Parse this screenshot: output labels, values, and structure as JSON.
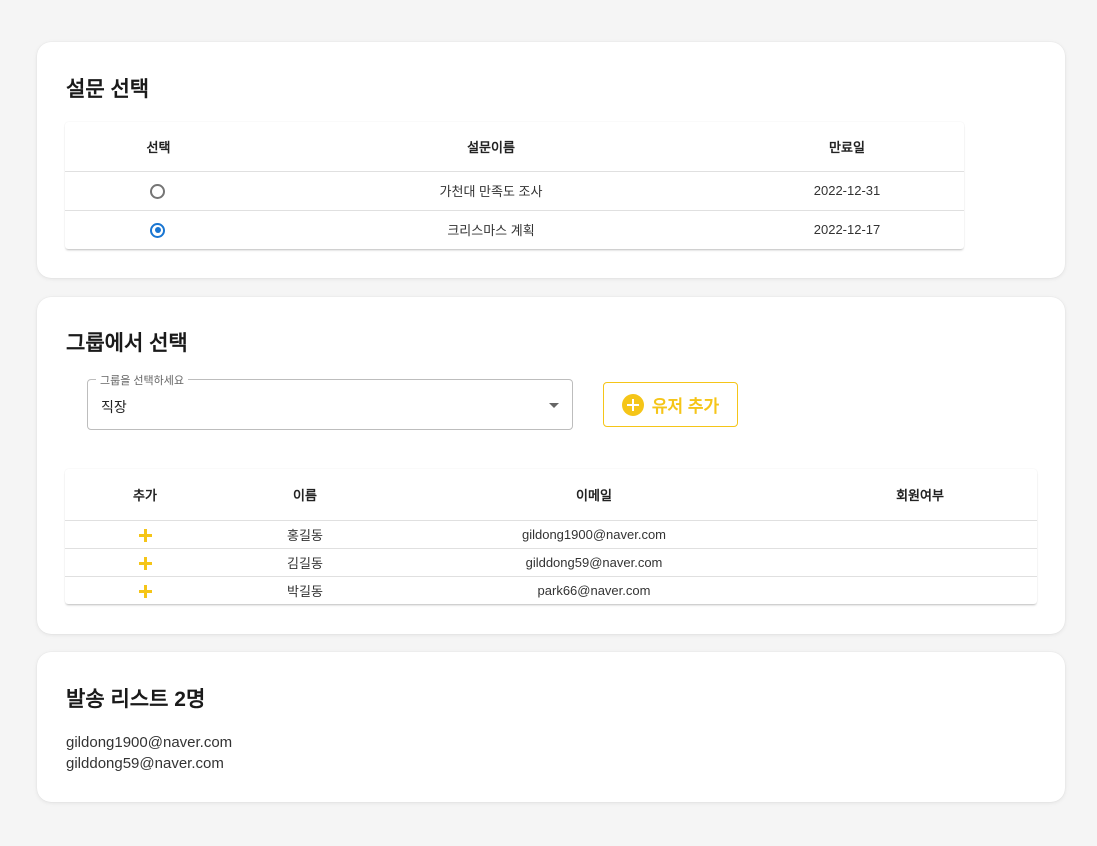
{
  "survey": {
    "title": "설문 선택",
    "columns": [
      "선택",
      "설문이름",
      "만료일"
    ],
    "rows": [
      {
        "name": "가천대 만족도 조사",
        "expires": "2022-12-31",
        "selected": false
      },
      {
        "name": "크리스마스 계획",
        "expires": "2022-12-17",
        "selected": true
      }
    ]
  },
  "group": {
    "title": "그룹에서 선택",
    "select_label": "그룹을 선택하세요",
    "select_value": "직장",
    "add_user_label": "유저 추가",
    "columns": [
      "추가",
      "이름",
      "이메일",
      "회원여부"
    ],
    "rows": [
      {
        "name": "홍길동",
        "email": "gildong1900@naver.com",
        "member": ""
      },
      {
        "name": "김길동",
        "email": "gilddong59@naver.com",
        "member": ""
      },
      {
        "name": "박길동",
        "email": "park66@naver.com",
        "member": ""
      }
    ]
  },
  "send_list": {
    "title": "발송 리스트 2명",
    "emails": [
      "gildong1900@naver.com",
      "gilddong59@naver.com"
    ]
  },
  "colors": {
    "accent_yellow": "#f5c518",
    "radio_selected": "#1976d2",
    "background": "#f5f5f5"
  },
  "icons": {
    "add_user": "plus-circle-icon",
    "add_row": "plus-icon",
    "select_arrow": "dropdown-arrow-icon"
  }
}
